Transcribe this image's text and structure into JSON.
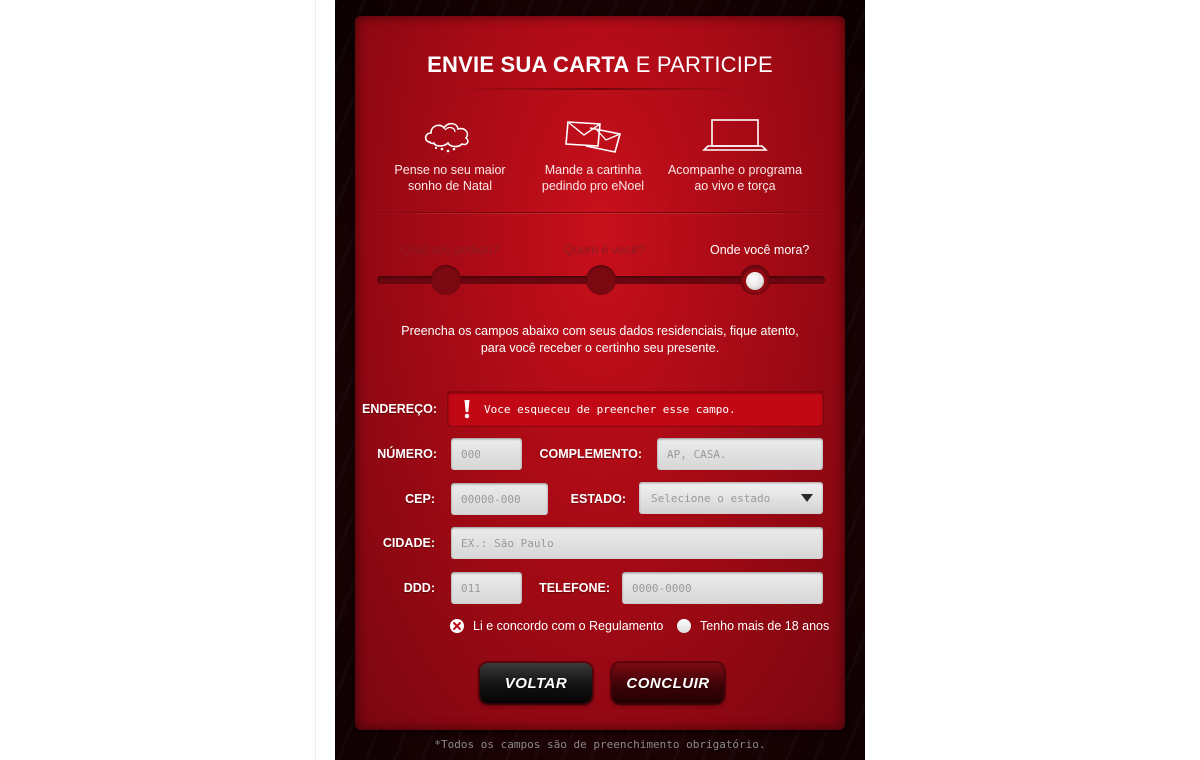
{
  "header": {
    "title_bold": "ENVIE SUA CARTA",
    "title_light": "E PARTICIPE"
  },
  "steps_top": [
    {
      "icon": "cloud-dream-icon",
      "line1": "Pense no seu maior",
      "line2": "sonho de Natal"
    },
    {
      "icon": "envelope-icon",
      "line1": "Mande a cartinha",
      "line2": "pedindo pro eNoel"
    },
    {
      "icon": "laptop-icon",
      "line1": "Acompanhe o programa",
      "line2": "ao vivo e torça"
    }
  ],
  "progress": {
    "steps": [
      "Qual seu pedido?",
      "Quem é você?",
      "Onde você mora?"
    ],
    "active_index": 2
  },
  "instructions": {
    "line1": "Preencha os campos abaixo com seus dados residenciais, fique atento,",
    "line2": "para você receber o certinho seu presente."
  },
  "form": {
    "endereco": {
      "label": "ENDEREÇO:",
      "error": "Voce esqueceu de preencher esse campo."
    },
    "numero": {
      "label": "NÚMERO:",
      "placeholder": "000"
    },
    "complemento": {
      "label": "COMPLEMENTO:",
      "placeholder": "AP, CASA."
    },
    "cep": {
      "label": "CEP:",
      "placeholder": "00000-000"
    },
    "estado": {
      "label": "ESTADO:",
      "selected": "Selecione o estado"
    },
    "cidade": {
      "label": "CIDADE:",
      "placeholder": "EX.: São Paulo"
    },
    "ddd": {
      "label": "DDD:",
      "placeholder": "011"
    },
    "telefone": {
      "label": "TELEFONE:",
      "placeholder": "0000-0000"
    }
  },
  "checks": {
    "regulamento": "Li e concordo com o Regulamento",
    "maior_idade": "Tenho mais de 18 anos"
  },
  "buttons": {
    "back": "VOLTAR",
    "submit": "CONCLUIR"
  },
  "footnote": "*Todos os campos são de preenchimento obrigatório.",
  "colors": {
    "card_red": "#c8101c",
    "error_red": "#c10815",
    "frame_dark": "#1c0204"
  }
}
